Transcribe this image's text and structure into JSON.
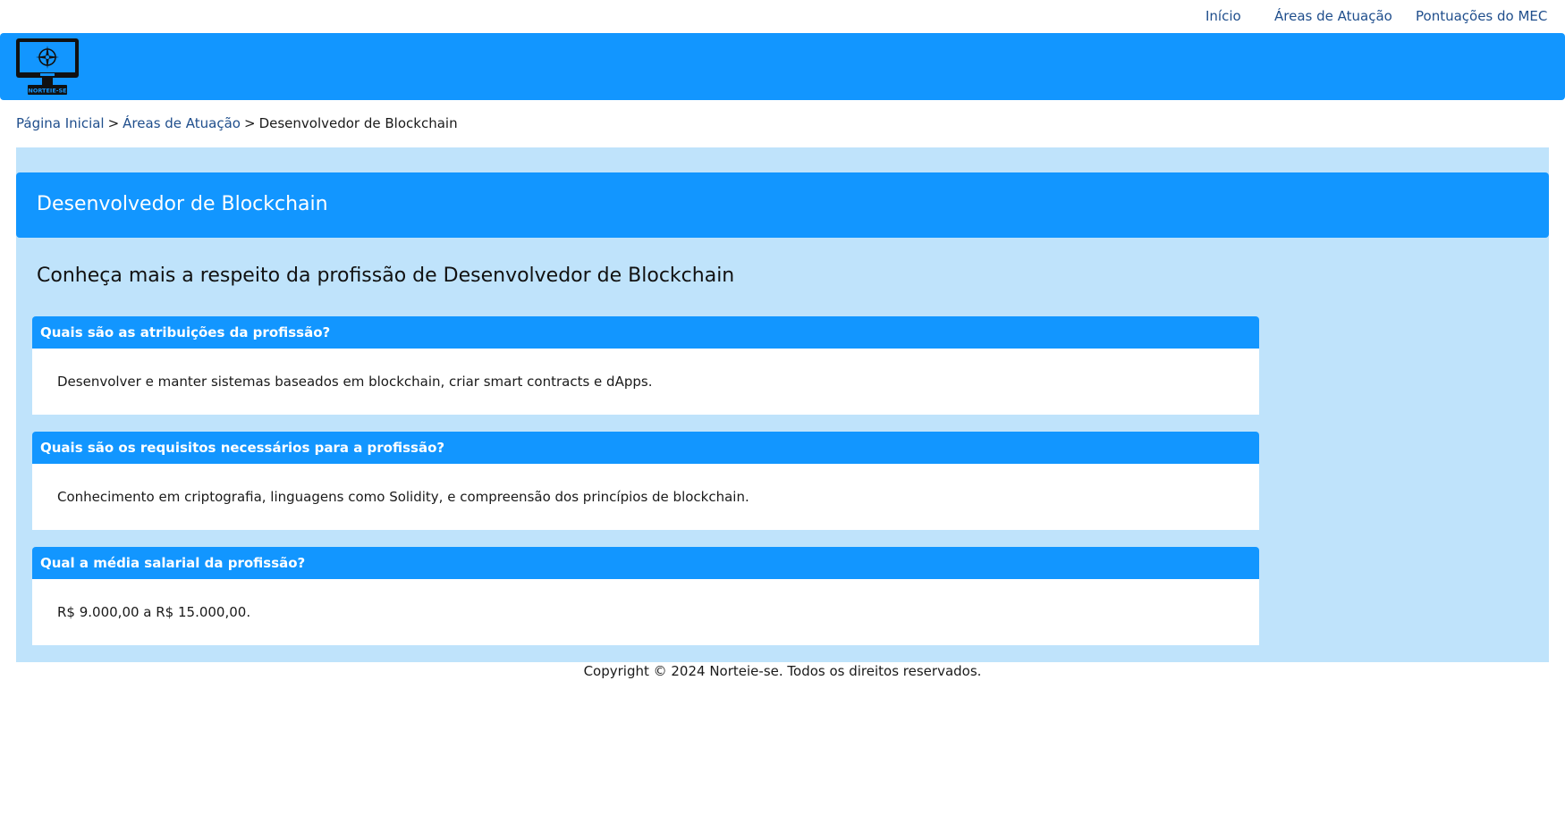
{
  "nav": {
    "items": [
      {
        "label": "Início"
      },
      {
        "label": "Áreas de Atuação"
      },
      {
        "label": "Pontuações do MEC"
      }
    ]
  },
  "header": {
    "brand_color": "#1296ff",
    "logo_icon": "computer-monitor-compass-logo",
    "logo_text": "NORTEIE-SE"
  },
  "breadcrumb": {
    "home": "Página Inicial",
    "areas": "Áreas de Atuação",
    "separator": ">",
    "current": "Desenvolvedor de Blockchain"
  },
  "main": {
    "title": "Desenvolvedor de Blockchain",
    "subtitle": "Conheça mais a respeito da profissão de Desenvolvedor de Blockchain",
    "cards": [
      {
        "question": "Quais são as atribuições da profissão?",
        "answer": "Desenvolver e manter sistemas baseados em blockchain, criar smart contracts e dApps."
      },
      {
        "question": "Quais são os requisitos necessários para a profissão?",
        "answer": "Conhecimento em criptografia, linguagens como Solidity, e compreensão dos princípios de blockchain."
      },
      {
        "question": "Qual a média salarial da profissão?",
        "answer": "R$ 9.000,00 a R$ 15.000,00."
      }
    ]
  },
  "footer": {
    "text": "Copyright © 2024 Norteie-se. Todos os direitos reservados."
  },
  "colors": {
    "accent": "#1296ff",
    "panel_bg": "#bfe3fb",
    "link": "#1f4e8c"
  }
}
